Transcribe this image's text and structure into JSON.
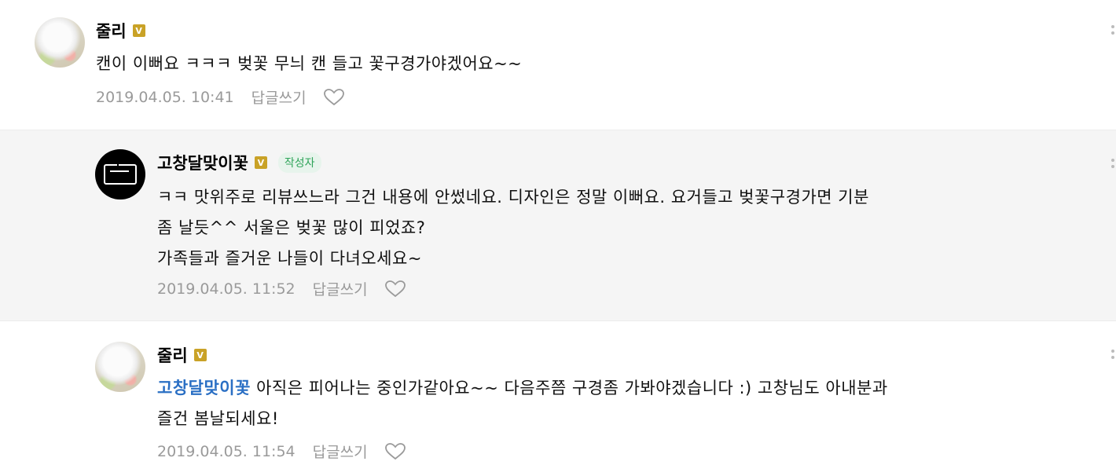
{
  "comments": [
    {
      "author": "줄리",
      "badge": "V",
      "text": "캔이 이뻐요 ㅋㅋㅋ 벚꽃 무늬 캔 들고 꽃구경가야겠어요~~",
      "timestamp": "2019.04.05. 10:41",
      "reply_label": "답글쓰기",
      "avatar_icon": "cat-photo"
    },
    {
      "author": "고창달맞이꽃",
      "badge": "V",
      "author_tag": "작성자",
      "text_lines": [
        "ㅋㅋ 맛위주로 리뷰쓰느라 그건 내용에 안썼네요. 디자인은 정말 이뻐요. 요거들고 벚꽃구경가면 기분",
        "좀 날듯^^ 서울은 벚꽃 많이 피었죠?",
        "가족들과 즐거운 나들이 다녀오세요~"
      ],
      "timestamp": "2019.04.05. 11:52",
      "reply_label": "답글쓰기",
      "avatar_icon": "gd-logo"
    },
    {
      "author": "줄리",
      "badge": "V",
      "mention": "고창달맞이꽃",
      "text_line1": " 아직은 피어나는 중인가같아요~~ 다음주쯤 구경좀 가봐야겠습니다 :) 고창님도 아내분과",
      "text_line2": "즐건 봄날되세요!",
      "timestamp": "2019.04.05. 11:54",
      "reply_label": "답글쓰기",
      "avatar_icon": "cat-photo"
    }
  ],
  "colors": {
    "badge": "#c9a227",
    "mention": "#2a6fc4",
    "author_tag": "#2fa45a",
    "reply_bg": "#f5f5f5"
  }
}
